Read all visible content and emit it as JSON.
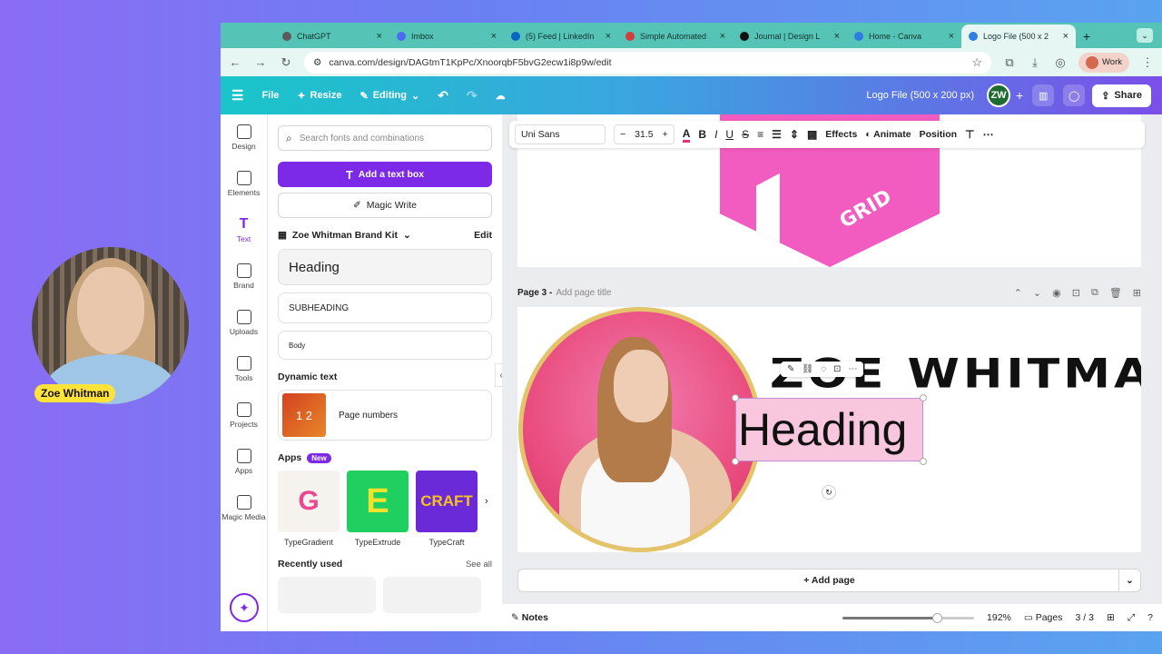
{
  "webcam": {
    "name": "Zoe Whitman"
  },
  "browser": {
    "tabs": [
      {
        "label": "ChatGPT",
        "color": "#5a5a5a"
      },
      {
        "label": "Imbox",
        "color": "#4b6cf0"
      },
      {
        "label": "(5) Feed | LinkedIn",
        "color": "#0a66c2"
      },
      {
        "label": "Simple Automated",
        "color": "#d23c3c"
      },
      {
        "label": "Journal | Design L",
        "color": "#111111"
      },
      {
        "label": "Home - Canva",
        "color": "#2f7de1"
      },
      {
        "label": "Logo File (500 x 2",
        "color": "#2f7de1"
      }
    ],
    "active_tab": 6,
    "url": "canva.com/design/DAGtmT1KpPc/XnoorqbF5bvG2ecw1i8p9w/edit",
    "profile_label": "Work"
  },
  "header": {
    "file": "File",
    "resize": "Resize",
    "editing": "Editing",
    "doc_title": "Logo File (500 x 200 px)",
    "avatar_initials": "ZW",
    "share": "Share"
  },
  "rail": [
    {
      "label": "Design",
      "icon": "design-icon"
    },
    {
      "label": "Elements",
      "icon": "elements-icon"
    },
    {
      "label": "Text",
      "icon": "text-icon",
      "active": true
    },
    {
      "label": "Brand",
      "icon": "brand-icon"
    },
    {
      "label": "Uploads",
      "icon": "uploads-icon"
    },
    {
      "label": "Tools",
      "icon": "tools-icon"
    },
    {
      "label": "Projects",
      "icon": "projects-icon"
    },
    {
      "label": "Apps",
      "icon": "apps-icon"
    },
    {
      "label": "Magic Media",
      "icon": "magic-media-icon"
    }
  ],
  "panel": {
    "search_placeholder": "Search fonts and combinations",
    "add_text_box": "Add a text box",
    "magic_write": "Magic Write",
    "brand_kit": "Zoe Whitman Brand Kit",
    "edit": "Edit",
    "styles": {
      "heading": "Heading",
      "subheading": "SUBHEADING",
      "body": "Body"
    },
    "dynamic_text": "Dynamic text",
    "page_numbers": "Page numbers",
    "page_numbers_thumb": "1 2",
    "apps_title": "Apps",
    "new_badge": "New",
    "apps": [
      {
        "label": "TypeGradient",
        "glyph": "G"
      },
      {
        "label": "TypeExtrude",
        "glyph": "E"
      },
      {
        "label": "TypeCraft",
        "glyph": "CRAFT"
      }
    ],
    "recently_used": "Recently used",
    "see_all": "See all"
  },
  "toolbar": {
    "font": "Uni Sans",
    "size": "31.5",
    "effects": "Effects",
    "animate": "Animate",
    "position": "Position"
  },
  "canvas": {
    "logo_text": "GRID",
    "page_label": "Page 3 -",
    "page_title_placeholder": "Add page title",
    "brand_name": "ZOE  WHITMAN",
    "selected_text": "Heading",
    "add_page": "+ Add page"
  },
  "footer": {
    "notes": "Notes",
    "zoom": "192%",
    "zoom_level": 0.72,
    "pages": "Pages",
    "page_count": "3 / 3"
  }
}
